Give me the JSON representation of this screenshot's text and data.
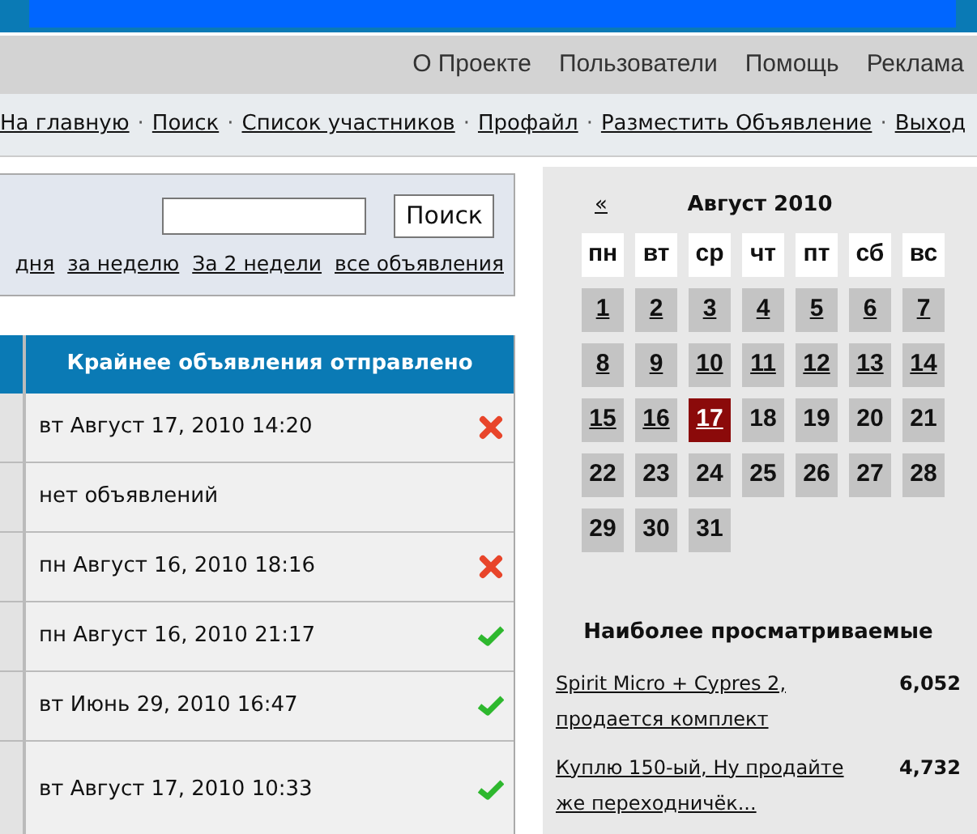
{
  "top_menu": [
    "О Проекте",
    "Пользователи",
    "Помощь",
    "Реклама"
  ],
  "nav_links": [
    {
      "kind": "link",
      "text": "На главную"
    },
    {
      "kind": "separator",
      "text": "·"
    },
    {
      "kind": "link",
      "text": "Поиск"
    },
    {
      "kind": "separator",
      "text": "·"
    },
    {
      "kind": "link",
      "text": "Список участников"
    },
    {
      "kind": "separator",
      "text": "·"
    },
    {
      "kind": "link",
      "text": "Профайл"
    },
    {
      "kind": "separator",
      "text": "·"
    },
    {
      "kind": "link",
      "text": "Разместить Объявление"
    },
    {
      "kind": "separator",
      "text": "·"
    },
    {
      "kind": "link",
      "text": "Выход"
    }
  ],
  "search": {
    "button": "Поиск",
    "period_links": [
      "дня",
      "за неделю",
      "За 2 недели",
      "все объявления"
    ]
  },
  "table": {
    "header": "Крайнее объявления отправлено",
    "rows": [
      {
        "text": "вт Август 17, 2010 14:20",
        "approved": false
      },
      {
        "text": "нет объявлений"
      },
      {
        "text": "пн Август 16, 2010 18:16",
        "approved": false
      },
      {
        "text": "пн Август 16, 2010 21:17",
        "approved": true
      },
      {
        "text": "вт Июнь 29, 2010 16:47",
        "approved": true
      },
      {
        "text": "вт Август 17, 2010 10:33",
        "approved": true
      }
    ]
  },
  "calendar": {
    "prev": "«",
    "title": "Август 2010",
    "weekdays": [
      "пн",
      "вт",
      "ср",
      "чт",
      "пт",
      "сб",
      "вс"
    ],
    "days": [
      {
        "text": "1",
        "link": true,
        "selected": false
      },
      {
        "text": "2",
        "link": true,
        "selected": false
      },
      {
        "text": "3",
        "link": true,
        "selected": false
      },
      {
        "text": "4",
        "link": true,
        "selected": false
      },
      {
        "text": "5",
        "link": true,
        "selected": false
      },
      {
        "text": "6",
        "link": true,
        "selected": false
      },
      {
        "text": "7",
        "link": true,
        "selected": false
      },
      {
        "text": "8",
        "link": true,
        "selected": false
      },
      {
        "text": "9",
        "link": true,
        "selected": false
      },
      {
        "text": "10",
        "link": true,
        "selected": false
      },
      {
        "text": "11",
        "link": true,
        "selected": false
      },
      {
        "text": "12",
        "link": true,
        "selected": false
      },
      {
        "text": "13",
        "link": true,
        "selected": false
      },
      {
        "text": "14",
        "link": true,
        "selected": false
      },
      {
        "text": "15",
        "link": true,
        "selected": false
      },
      {
        "text": "16",
        "link": true,
        "selected": false
      },
      {
        "text": "17",
        "link": true,
        "selected": true
      },
      {
        "text": "18",
        "link": false,
        "selected": false
      },
      {
        "text": "19",
        "link": false,
        "selected": false
      },
      {
        "text": "20",
        "link": false,
        "selected": false
      },
      {
        "text": "21",
        "link": false,
        "selected": false
      },
      {
        "text": "22",
        "link": false,
        "selected": false
      },
      {
        "text": "23",
        "link": false,
        "selected": false
      },
      {
        "text": "24",
        "link": false,
        "selected": false
      },
      {
        "text": "25",
        "link": false,
        "selected": false
      },
      {
        "text": "26",
        "link": false,
        "selected": false
      },
      {
        "text": "27",
        "link": false,
        "selected": false
      },
      {
        "text": "28",
        "link": false,
        "selected": false
      },
      {
        "text": "29",
        "link": false,
        "selected": false
      },
      {
        "text": "30",
        "link": false,
        "selected": false
      },
      {
        "text": "31",
        "link": false,
        "selected": false
      }
    ]
  },
  "most_viewed": {
    "title": "Наиболее просматриваемые",
    "items": [
      {
        "title": "Spirit Micro + Cypres 2, продается комплект",
        "views": "6,052"
      },
      {
        "title": "Куплю 150-ый, Ну продайте же переходничёк...",
        "views": "4,732"
      }
    ]
  }
}
